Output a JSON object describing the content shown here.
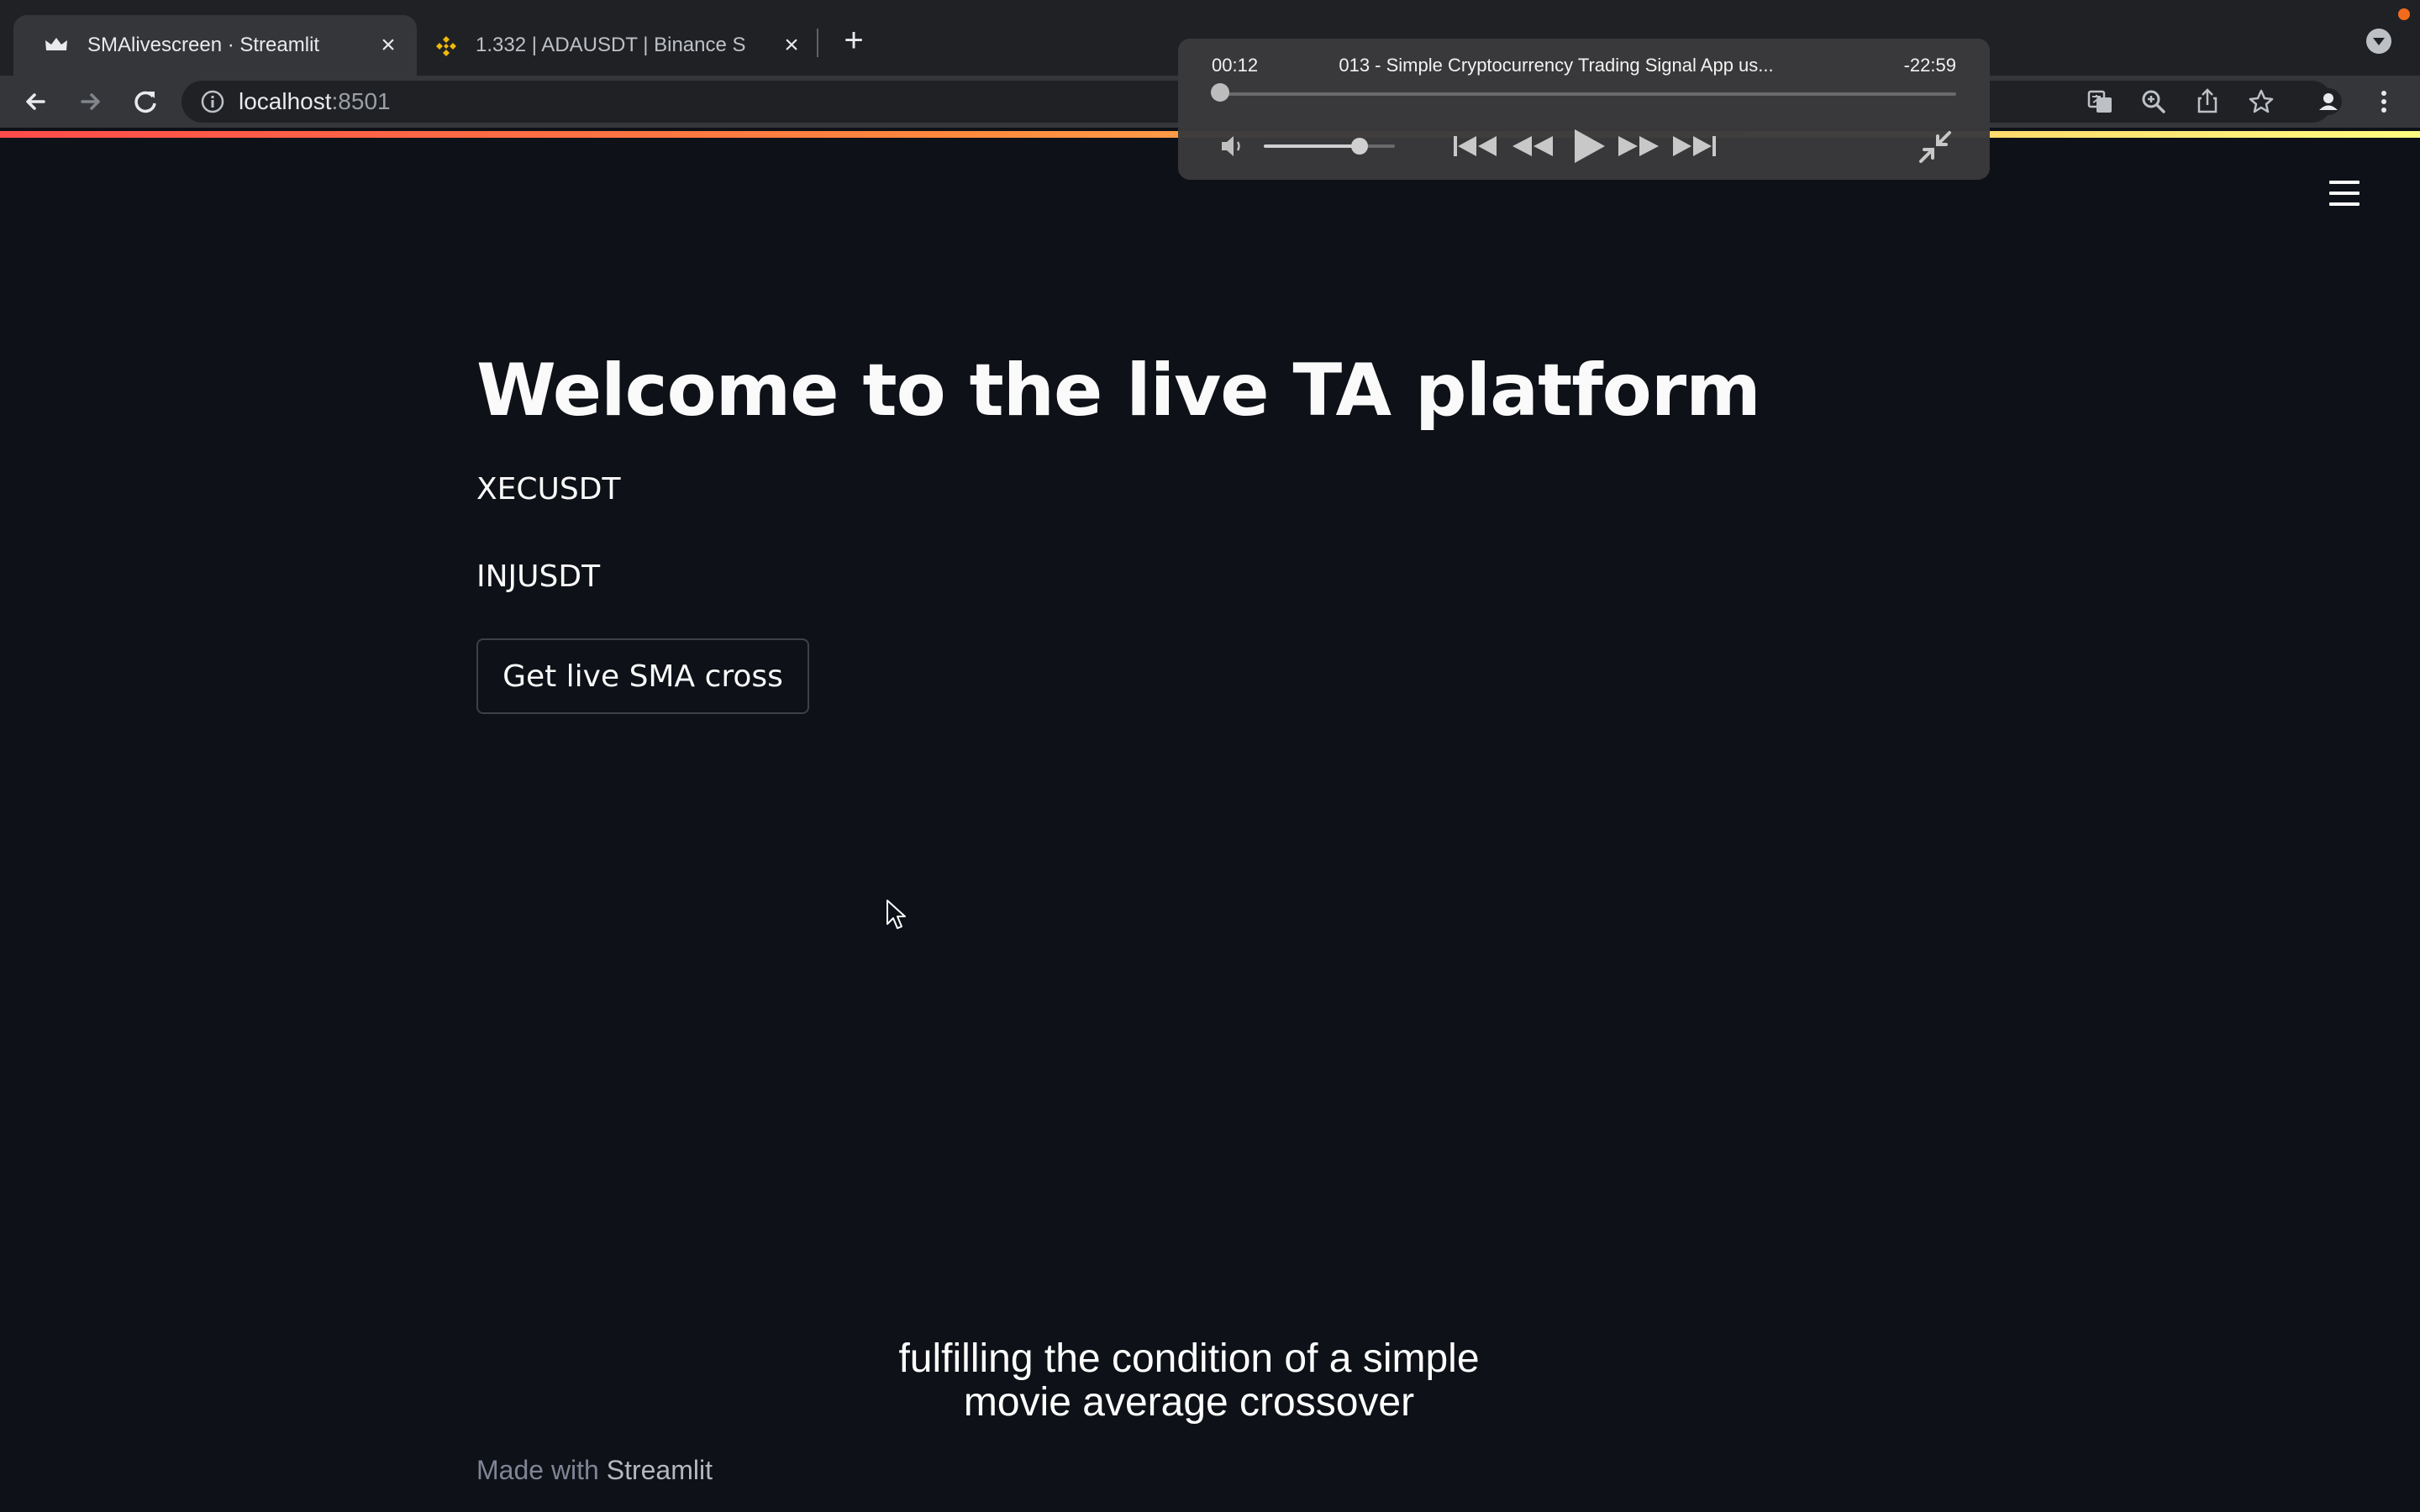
{
  "browser": {
    "tabs": [
      {
        "title": "SMAlivescreen · Streamlit",
        "favicon": "streamlit-crown-icon",
        "active": true
      },
      {
        "title": "1.332  |  ADAUSDT | Binance S",
        "favicon": "binance-icon",
        "active": false
      }
    ],
    "url_host": "localhost",
    "url_port": ":8501"
  },
  "colors": {
    "page_bg": "#0e1117",
    "text": "#fafafa",
    "accent_start": "#ff4b4b",
    "accent_end": "#fffd80"
  },
  "player": {
    "elapsed": "00:12",
    "title": "013 - Simple Cryptocurrency Trading Signal App us...",
    "remaining": "-22:59",
    "progress_fraction": 0.011,
    "volume_fraction": 0.73
  },
  "main": {
    "title": "Welcome to the live TA platform",
    "symbols": [
      "XECUSDT",
      "INJUSDT"
    ],
    "button_label": "Get live SMA cross"
  },
  "subtitle": {
    "line1": "fulfilling the condition of a simple",
    "line2": "movie average crossover"
  },
  "footer": {
    "prefix": "Made with",
    "brand": "Streamlit"
  }
}
